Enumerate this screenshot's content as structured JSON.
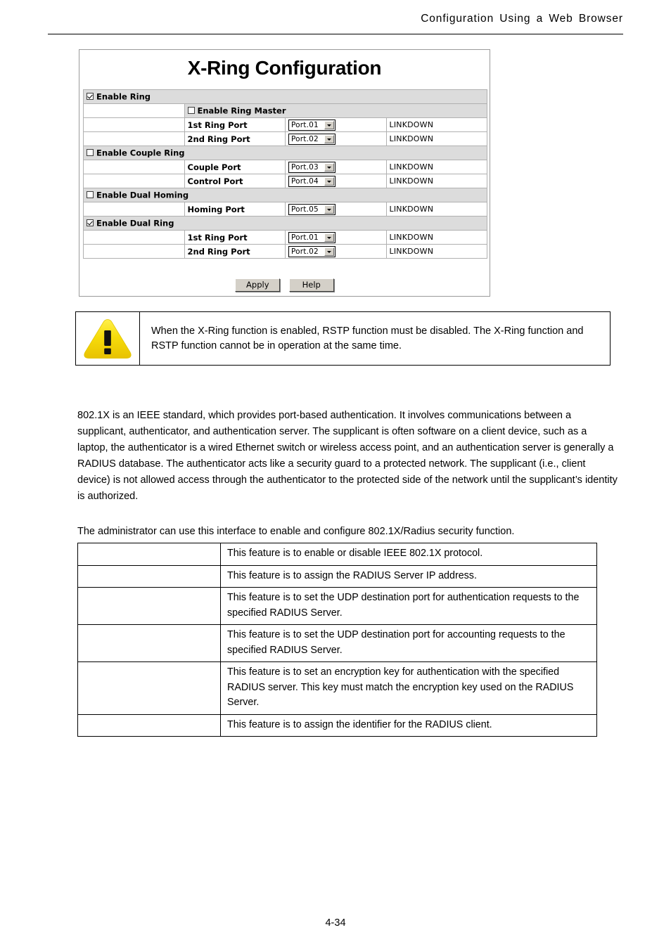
{
  "header": {
    "running_head": "Configuration  Using  a  Web  Browser"
  },
  "xring": {
    "title": "X-Ring Configuration",
    "rows": [
      {
        "kind": "group",
        "checkbox": "checked",
        "label": "Enable Ring"
      },
      {
        "kind": "sub",
        "checkbox": "unchecked",
        "label": "Enable Ring Master",
        "shaded": true
      },
      {
        "kind": "sub",
        "label": "1st Ring Port",
        "select": "Port.01",
        "status": "LINKDOWN"
      },
      {
        "kind": "sub",
        "label": "2nd Ring Port",
        "select": "Port.02",
        "status": "LINKDOWN"
      },
      {
        "kind": "group",
        "checkbox": "unchecked",
        "label": "Enable Couple Ring"
      },
      {
        "kind": "sub",
        "label": "Couple Port",
        "select": "Port.03",
        "status": "LINKDOWN"
      },
      {
        "kind": "sub",
        "label": "Control Port",
        "select": "Port.04",
        "status": "LINKDOWN"
      },
      {
        "kind": "group",
        "checkbox": "unchecked",
        "label": "Enable Dual Homing"
      },
      {
        "kind": "sub",
        "label": "Homing Port",
        "select": "Port.05",
        "status": "LINKDOWN"
      },
      {
        "kind": "group",
        "checkbox": "checked",
        "label": "Enable Dual Ring"
      },
      {
        "kind": "sub",
        "label": "1st Ring Port",
        "select": "Port.01",
        "status": "LINKDOWN"
      },
      {
        "kind": "sub",
        "label": "2nd Ring Port",
        "select": "Port.02",
        "status": "LINKDOWN"
      }
    ],
    "apply_label": "Apply",
    "help_label": "Help"
  },
  "warning": {
    "icon": "warning-triangle-icon",
    "icon_color": "#F5D808",
    "text": "When the X-Ring function is enabled, RSTP function must be disabled. The X-Ring function and RSTP function cannot be in operation at the same time."
  },
  "paragraphs": {
    "intro_8021x": "802.1X is an IEEE standard, which provides port-based authentication. It involves communications between a supplicant, authenticator, and authentication server. The supplicant is often software on a client device, such as a laptop, the authenticator is a wired Ethernet switch or wireless access point, and an authentication server is generally a RADIUS database. The authenticator acts like a security guard to a protected network. The supplicant (i.e., client device) is not allowed access through the authenticator to the protected side of the network until the supplicant’s identity is authorized.",
    "admin_note": "The administrator can use this interface to enable and configure 802.1X/Radius security function."
  },
  "feature_table": {
    "rows": [
      {
        "name": "",
        "description": "This feature is to enable or disable IEEE 802.1X protocol."
      },
      {
        "name": "",
        "description": "This feature is to assign the RADIUS Server IP address."
      },
      {
        "name": "",
        "description": "This feature is to set the UDP destination port for authentication requests to the specified RADIUS Server."
      },
      {
        "name": "",
        "description": "This feature is to set the UDP destination port for accounting requests to the specified RADIUS Server."
      },
      {
        "name": "",
        "description": "This feature is to set an encryption key for authentication with the specified RADIUS server. This key must match the encryption key used on the RADIUS Server."
      },
      {
        "name": "",
        "description": "This feature is to assign the identifier for the RADIUS client."
      }
    ]
  },
  "footer": {
    "page_number": "4-34"
  }
}
